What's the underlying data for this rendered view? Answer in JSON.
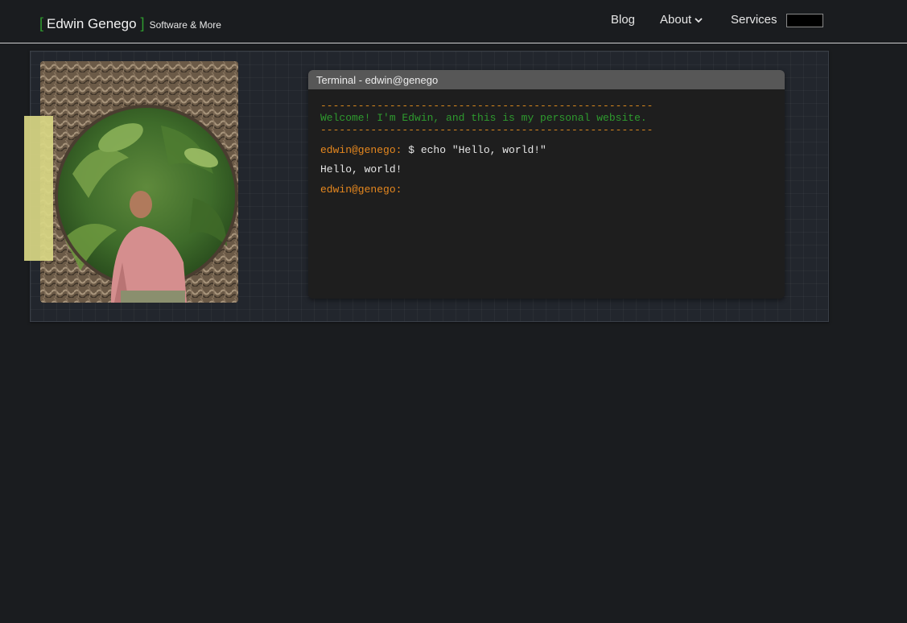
{
  "header": {
    "bracket_open": "[",
    "brand_name": "Edwin Genego",
    "bracket_close": "]",
    "brand_subtitle": "Software & More",
    "nav": {
      "blog": "Blog",
      "about": "About",
      "services": "Services"
    }
  },
  "terminal": {
    "title": "Terminal - edwin@genego",
    "rule": "-----------------------------------------------------",
    "welcome": "Welcome! I'm Edwin, and this is my personal website.",
    "prompt": "edwin@genego:",
    "command": " $ echo \"Hello, world!\"",
    "output": "Hello, world!",
    "prompt2": "edwin@genego:"
  },
  "colors": {
    "background": "#1a1c1f",
    "accent_green": "#2e9a2e",
    "accent_orange": "#e5871e",
    "accent_bar": "#d9d784"
  },
  "icons": {
    "about_dropdown": "chevron-down-icon"
  }
}
